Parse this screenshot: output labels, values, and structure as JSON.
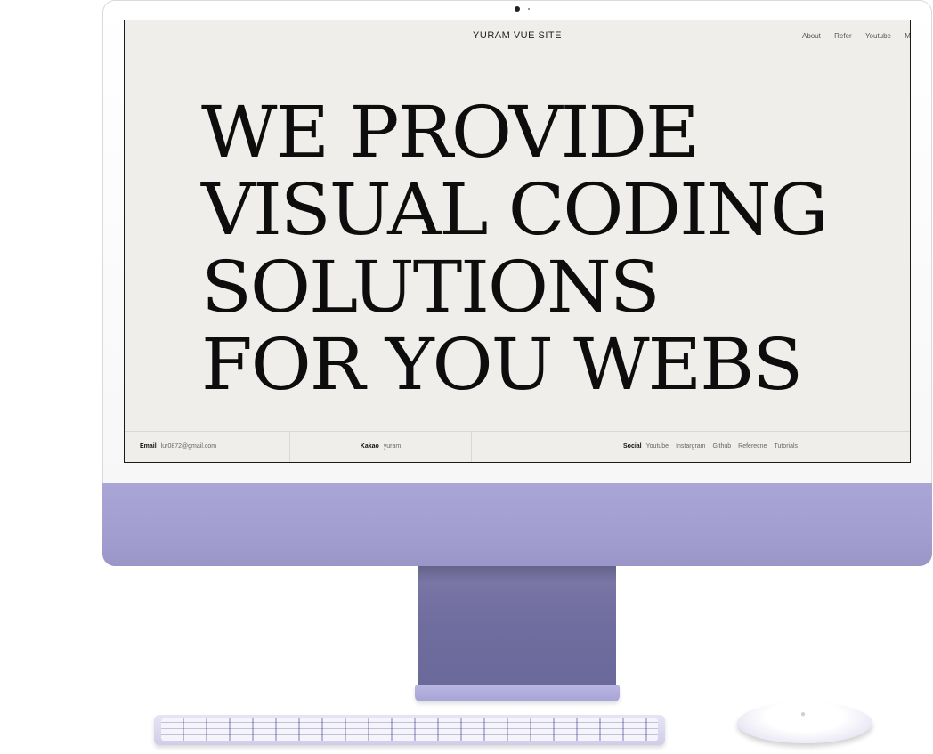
{
  "site": {
    "title": "YURAM VUE SITE",
    "nav": [
      "About",
      "Refer",
      "Youtube",
      "M"
    ]
  },
  "hero": {
    "lines": [
      "WE PROVIDE",
      "VISUAL CODING",
      "SOLUTIONS",
      "FOR YOU WEBS"
    ]
  },
  "footer": {
    "email_label": "Email",
    "email_value": "lur0872@gmail.com",
    "kakao_label": "Kakao",
    "kakao_value": "yuram",
    "social_label": "Social",
    "social_links": [
      "Youtube",
      "Instargram",
      "Github",
      "Referecne",
      "Tutorials"
    ]
  },
  "colors": {
    "screen_bg": "#efeeea",
    "text": "#0d0d0d",
    "imac_purple": "#a29ed0"
  },
  "icons": {
    "camera": "camera-icon",
    "logo": "apple-logo-icon"
  }
}
